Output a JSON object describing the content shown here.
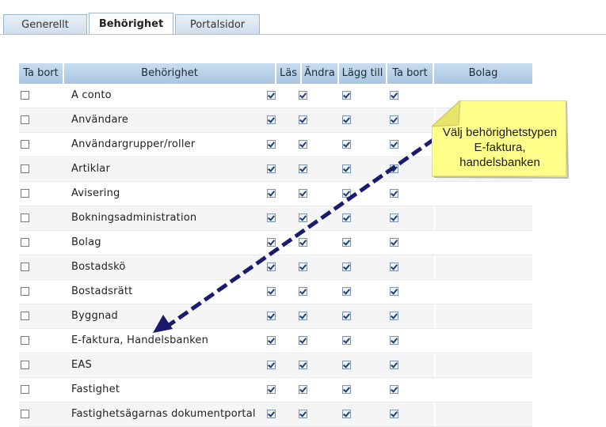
{
  "tabs": [
    {
      "label": "Generellt",
      "active": false
    },
    {
      "label": "Behörighet",
      "active": true
    },
    {
      "label": "Portalsidor",
      "active": false
    }
  ],
  "grid": {
    "headers": {
      "delete": "Ta bort",
      "permission": "Behörighet",
      "read": "Läs",
      "edit": "Ändra",
      "add": "Lägg till",
      "remove": "Ta bort",
      "company": "Bolag"
    },
    "rows": [
      {
        "name": "A conto",
        "delete": false,
        "read": true,
        "edit": true,
        "add": true,
        "remove": true
      },
      {
        "name": "Användare",
        "delete": false,
        "read": true,
        "edit": true,
        "add": true,
        "remove": true
      },
      {
        "name": "Användargrupper/roller",
        "delete": false,
        "read": true,
        "edit": true,
        "add": true,
        "remove": true
      },
      {
        "name": "Artiklar",
        "delete": false,
        "read": true,
        "edit": true,
        "add": true,
        "remove": true
      },
      {
        "name": "Avisering",
        "delete": false,
        "read": true,
        "edit": true,
        "add": true,
        "remove": true
      },
      {
        "name": "Bokningsadministration",
        "delete": false,
        "read": true,
        "edit": true,
        "add": true,
        "remove": true
      },
      {
        "name": "Bolag",
        "delete": false,
        "read": true,
        "edit": true,
        "add": true,
        "remove": true
      },
      {
        "name": "Bostadskö",
        "delete": false,
        "read": true,
        "edit": true,
        "add": true,
        "remove": true
      },
      {
        "name": "Bostadsrätt",
        "delete": false,
        "read": true,
        "edit": true,
        "add": true,
        "remove": true
      },
      {
        "name": "Byggnad",
        "delete": false,
        "read": true,
        "edit": true,
        "add": true,
        "remove": true
      },
      {
        "name": "E-faktura, Handelsbanken",
        "delete": false,
        "read": true,
        "edit": true,
        "add": true,
        "remove": true
      },
      {
        "name": "EAS",
        "delete": false,
        "read": true,
        "edit": true,
        "add": true,
        "remove": true
      },
      {
        "name": "Fastighet",
        "delete": false,
        "read": true,
        "edit": true,
        "add": true,
        "remove": true
      },
      {
        "name": "Fastighetsägarnas dokumentportal",
        "delete": false,
        "read": true,
        "edit": true,
        "add": true,
        "remove": true
      }
    ]
  },
  "callout": {
    "line1": "Välj behörighetstypen",
    "line2": "E-faktura,",
    "line3": "handelsbanken",
    "color": "#ffff88"
  },
  "colors": {
    "header_bg": "#b4cfe8",
    "arrow": "#1a1a6e",
    "row_alt": "#f5f5f5"
  }
}
